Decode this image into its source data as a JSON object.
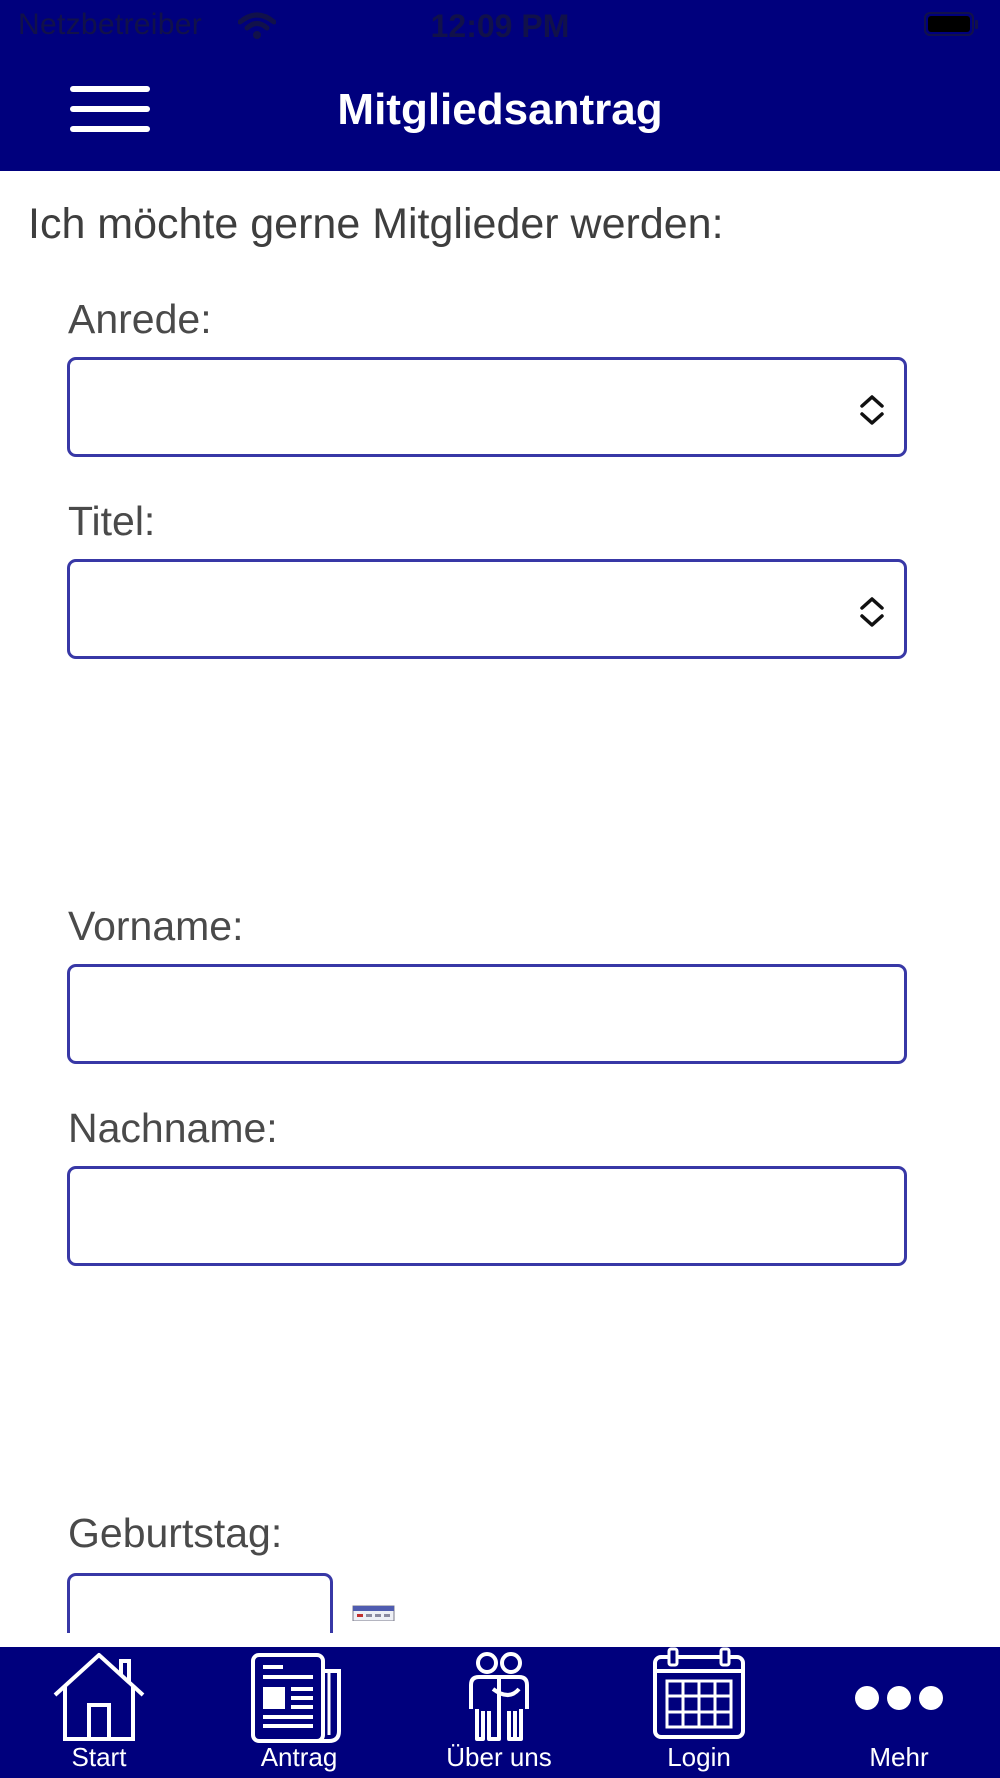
{
  "status_bar": {
    "carrier": "Netzbetreiber",
    "time": "12:09 PM"
  },
  "header": {
    "title": "Mitgliedsantrag"
  },
  "form": {
    "intro": "Ich möchte gerne Mitglieder werden:",
    "anrede": {
      "label": "Anrede:",
      "value": ""
    },
    "titel": {
      "label": "Titel:",
      "value": ""
    },
    "vorname": {
      "label": "Vorname:",
      "value": ""
    },
    "nachname": {
      "label": "Nachname:",
      "value": ""
    },
    "geburtstag": {
      "label": "Geburtstag:",
      "value": ""
    }
  },
  "tabbar": {
    "tabs": [
      {
        "label": "Start",
        "icon": "house-icon"
      },
      {
        "label": "Antrag",
        "icon": "newspaper-icon"
      },
      {
        "label": "Über uns",
        "icon": "people-icon"
      },
      {
        "label": "Login",
        "icon": "calendar-icon"
      },
      {
        "label": "Mehr",
        "icon": "more-dots-icon"
      }
    ]
  },
  "colors": {
    "primary": "#00007d",
    "field_border": "#3838a6",
    "text": "#4a4a4a"
  }
}
